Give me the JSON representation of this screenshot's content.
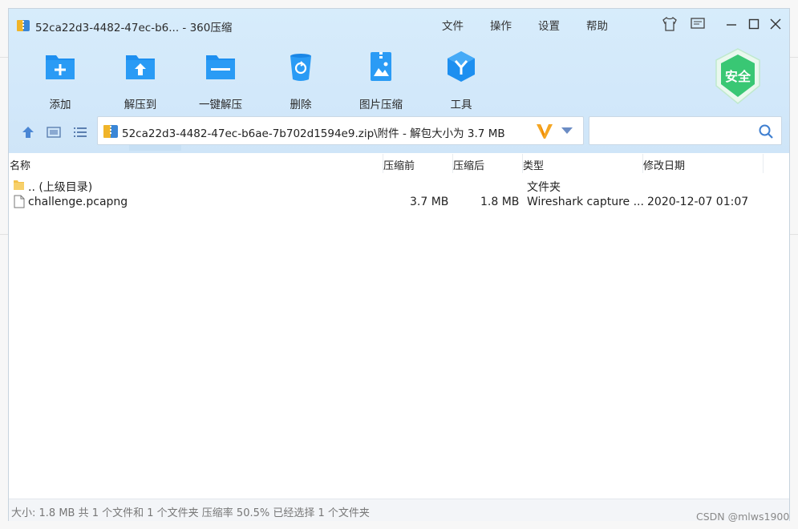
{
  "window": {
    "title": "52ca22d3-4482-47ec-b6... - 360压缩"
  },
  "menu": [
    "文件",
    "操作",
    "设置",
    "帮助"
  ],
  "toolbar": {
    "items": [
      {
        "label": "添加",
        "icon": "add-folder-icon"
      },
      {
        "label": "解压到",
        "icon": "extract-to-icon"
      },
      {
        "label": "一键解压",
        "icon": "one-click-extract-icon"
      },
      {
        "label": "删除",
        "icon": "delete-icon"
      },
      {
        "label": "图片压缩",
        "icon": "image-compress-icon"
      },
      {
        "label": "工具",
        "icon": "tools-icon"
      }
    ],
    "badge": "安全"
  },
  "address": {
    "path": "52ca22d3-4482-47ec-b6ae-7b702d1594e9.zip\\附件 - 解包大小为 3.7 MB",
    "search_placeholder": ""
  },
  "columns": [
    "名称",
    "压缩前",
    "压缩后",
    "类型",
    "修改日期"
  ],
  "rows": [
    {
      "name": ".. (上级目录)",
      "before": "",
      "after": "",
      "type": "文件夹",
      "date": "",
      "icon": "folder-icon"
    },
    {
      "name": "challenge.pcapng",
      "before": "3.7 MB",
      "after": "1.8 MB",
      "type": "Wireshark capture ...",
      "date": "2020-12-07 01:07",
      "icon": "file-icon"
    }
  ],
  "status": {
    "text": "大小: 1.8 MB 共 1 个文件和 1 个文件夹 压缩率 50.5% 已经选择 1 个文件夹"
  },
  "watermark": "CSDN @mlws1900",
  "colors": {
    "accent": "#1e90e8",
    "toolbar_bg": "#d4e9fa",
    "badge_green": "#2fc46a"
  }
}
